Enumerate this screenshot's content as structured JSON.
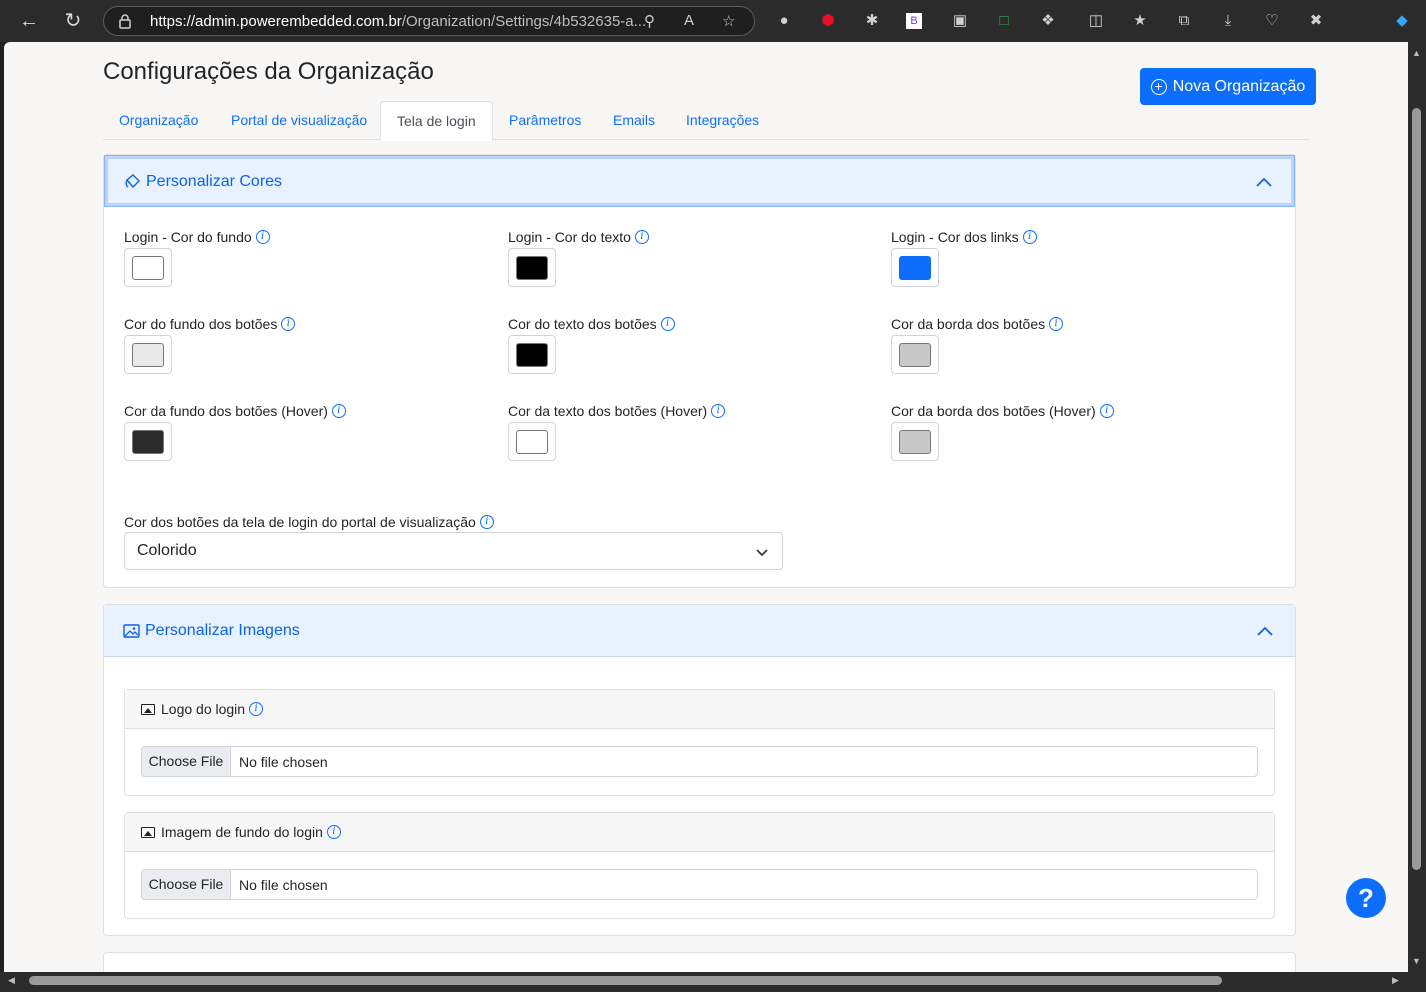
{
  "browser": {
    "url_host": "https://admin.powerembedded.com.br",
    "url_path": "/Organization/Settings/4b532635-a..."
  },
  "page": {
    "title": "Configurações da Organização",
    "new_button": "Nova Organização"
  },
  "tabs": [
    {
      "label": "Organização"
    },
    {
      "label": "Portal de visualização"
    },
    {
      "label": "Tela de login"
    },
    {
      "label": "Parâmetros"
    },
    {
      "label": "Emails"
    },
    {
      "label": "Integrações"
    }
  ],
  "active_tab": "Tela de login",
  "colors_section": {
    "title": "Personalizar Cores",
    "fields": [
      {
        "label": "Login - Cor do fundo",
        "color": "#ffffff"
      },
      {
        "label": "Login - Cor do texto",
        "color": "#000000"
      },
      {
        "label": "Login - Cor dos links",
        "color": "#0d6efd"
      },
      {
        "label": "Cor do fundo dos botões",
        "color": "#e9e9e9"
      },
      {
        "label": "Cor do texto dos botões",
        "color": "#000000"
      },
      {
        "label": "Cor da borda dos botões",
        "color": "#c8c8c8"
      },
      {
        "label": "Cor da fundo dos botões (Hover)",
        "color": "#2b2b2b"
      },
      {
        "label": "Cor da texto dos botões (Hover)",
        "color": "#ffffff"
      },
      {
        "label": "Cor da borda dos botões (Hover)",
        "color": "#c8c8c8"
      }
    ],
    "select_label": "Cor dos botões da tela de login do portal de visualização",
    "select_value": "Colorido"
  },
  "images_section": {
    "title": "Personalizar Imagens",
    "items": [
      {
        "label": "Logo do login",
        "button": "Choose File",
        "status": "No file chosen"
      },
      {
        "label": "Imagem de fundo do login",
        "button": "Choose File",
        "status": "No file chosen"
      }
    ]
  },
  "help": "?"
}
